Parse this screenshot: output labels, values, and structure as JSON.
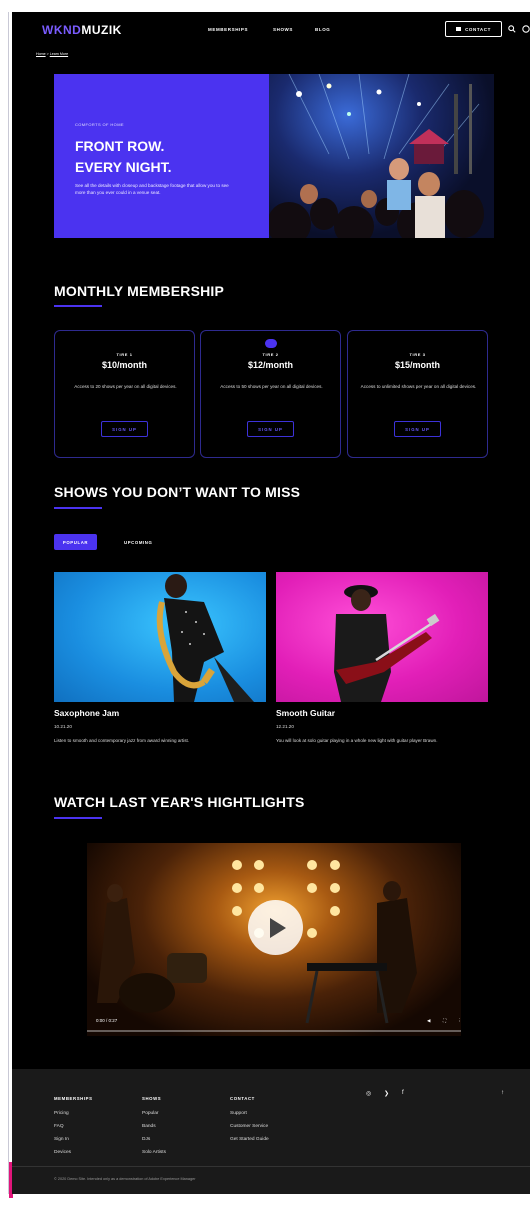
{
  "header": {
    "logo_part1": "WKND",
    "logo_part2": "MUZIK",
    "nav": [
      "MEMBERSHIPS",
      "SHOWS",
      "BLOG"
    ],
    "contact_label": "CONTACT",
    "icons": [
      "search-icon",
      "user-icon"
    ]
  },
  "breadcrumb": {
    "home": "Home",
    "sep": " > ",
    "current": "Learn More"
  },
  "hero": {
    "kicker": "COMFORTS OF HOME",
    "title_line1": "FRONT ROW.",
    "title_line2": "EVERY NIGHT.",
    "text": "See all the details with closeup and backstage footage that allow you to see more than you ever could in a venue seat."
  },
  "membership": {
    "title": "MONTHLY MEMBERSHIP",
    "tiers": [
      {
        "tier": "TIRE 1",
        "price": "$10/month",
        "desc": "Access to 20 shows per year on all digital devices.",
        "button": "SIGN UP"
      },
      {
        "tier": "TIRE 2",
        "price": "$12/month",
        "desc": "Access to 50 shows per year on all digital devices.",
        "button": "SIGN UP"
      },
      {
        "tier": "TIRE 3",
        "price": "$15/month",
        "desc": "Access to unlimited shows per year on all digital devices.",
        "button": "SIGN UP"
      }
    ]
  },
  "shows": {
    "title": "SHOWS YOU DON’T WANT TO MISS",
    "tab_popular": "POPULAR",
    "tab_upcoming": "UPCOMING",
    "items": [
      {
        "title": "Saxophone Jam",
        "date": "10.21.20",
        "desc": "Listen to smooth and contemporary jazz from award winning artist."
      },
      {
        "title": "Smooth Guitar",
        "date": "12.21.20",
        "desc": "You will look at solo guitar playing in a whole new light with guitar player Brawn."
      }
    ]
  },
  "highlights": {
    "title": "WATCH LAST YEAR'S HIGHTLIGHTS",
    "time": "0:00 / 0:27"
  },
  "footer": {
    "col1_title": "MEMBERSHIPS",
    "col1_links": [
      "Pricing",
      "FAQ",
      "Sign In",
      "Devices"
    ],
    "col2_title": "SHOWS",
    "col2_links": [
      "Popular",
      "Bands",
      "DJs",
      "Solo Artists"
    ],
    "col3_title": "CONTACT",
    "col3_links": [
      "Support",
      "Customer Service",
      "Get Started Guide"
    ],
    "social": [
      "instagram-icon",
      "twitter-icon",
      "facebook-icon"
    ],
    "copyright": "© 2020 Demo Site. Intended only as a demonstration of Adobe Experience Manager"
  },
  "colors": {
    "accent": "#4b33f0",
    "background": "#000000",
    "footer": "#1a1a1a",
    "logo_accent": "#7a5cff"
  }
}
